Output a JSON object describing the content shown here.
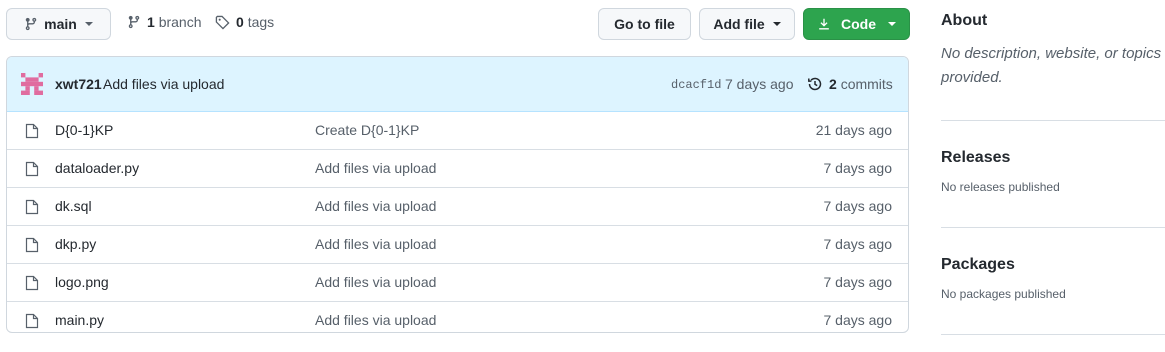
{
  "toolbar": {
    "branch_label": "main",
    "branches_count": "1",
    "branches_label": "branch",
    "tags_count": "0",
    "tags_label": "tags",
    "goto_file": "Go to file",
    "add_file": "Add file",
    "code": "Code"
  },
  "commit": {
    "author": "xwt721",
    "message": "Add files via upload",
    "hash": "dcacf1d",
    "age": "7 days ago",
    "commits_count": "2",
    "commits_label": "commits"
  },
  "files": [
    {
      "name": "D{0-1}KP",
      "message": "Create D{0-1}KP",
      "age": "21 days ago"
    },
    {
      "name": "dataloader.py",
      "message": "Add files via upload",
      "age": "7 days ago"
    },
    {
      "name": "dk.sql",
      "message": "Add files via upload",
      "age": "7 days ago"
    },
    {
      "name": "dkp.py",
      "message": "Add files via upload",
      "age": "7 days ago"
    },
    {
      "name": "logo.png",
      "message": "Add files via upload",
      "age": "7 days ago"
    },
    {
      "name": "main.py",
      "message": "Add files via upload",
      "age": "7 days ago"
    }
  ],
  "sidebar": {
    "about_title": "About",
    "about_text": "No description, website, or topics provided.",
    "releases_title": "Releases",
    "releases_text": "No releases published",
    "packages_title": "Packages",
    "packages_text": "No packages published"
  },
  "colors": {
    "code_button": "#2da44e",
    "commit_bar": "#ddf4ff",
    "avatar": "#e06c9f"
  }
}
